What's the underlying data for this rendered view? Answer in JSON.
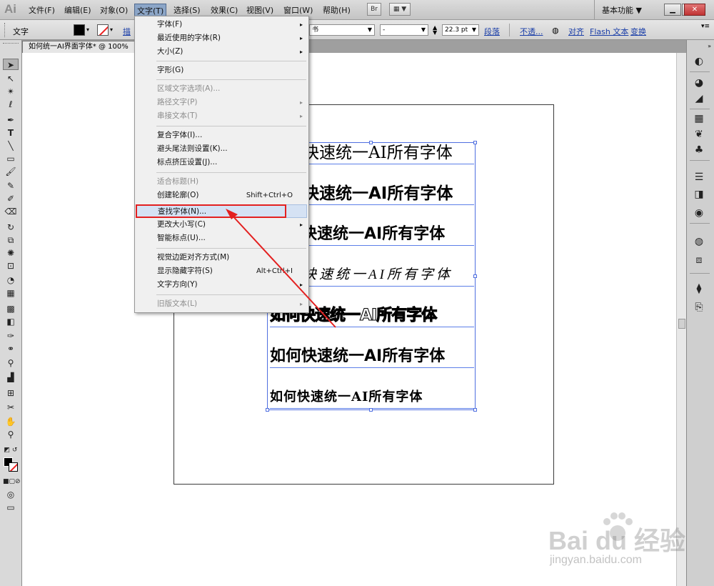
{
  "app": {
    "logo": "Ai",
    "workspace": "基本功能 ▼"
  },
  "menubar": {
    "items": [
      "文件(F)",
      "编辑(E)",
      "对象(O)",
      "文字(T)",
      "选择(S)",
      "效果(C)",
      "视图(V)",
      "窗口(W)",
      "帮助(H)"
    ],
    "br": "Br",
    "grid_arrow": "▼"
  },
  "controlbar": {
    "tool_label": "文字",
    "desc_label": "描",
    "font_style": "-",
    "font_size": "22.3 pt",
    "paragraph": "段落",
    "opacity": "不透...",
    "align": "对齐",
    "flash": "Flash 文本",
    "transform": "变换",
    "font_tail": "书"
  },
  "document": {
    "tab_title": "如何统一AI界面字体* @ 100%"
  },
  "artwork": {
    "lines": [
      "如何快速统一AI所有字体",
      "如何快速统一AI所有字体",
      "如何快速统一AI所有字体",
      "如何快速统一AI所有字体",
      "如何快速统一AI所有字体",
      "如何快速统一AI所有字体",
      "如何快速统一AI所有字体"
    ]
  },
  "dropdown": {
    "items": [
      {
        "label": "字体(F)",
        "sub": "▸",
        "shortcut": ""
      },
      {
        "label": "最近使用的字体(R)",
        "sub": "▸",
        "shortcut": ""
      },
      {
        "label": "大小(Z)",
        "sub": "▸",
        "shortcut": ""
      },
      {
        "label": "字形(G)",
        "sub": "",
        "shortcut": ""
      },
      {
        "label": "区域文字选项(A)...",
        "sub": "",
        "shortcut": ""
      },
      {
        "label": "路径文字(P)",
        "sub": "▸",
        "shortcut": ""
      },
      {
        "label": "串接文本(T)",
        "sub": "▸",
        "shortcut": ""
      },
      {
        "label": "复合字体(I)...",
        "sub": "",
        "shortcut": ""
      },
      {
        "label": "避头尾法则设置(K)...",
        "sub": "",
        "shortcut": ""
      },
      {
        "label": "标点挤压设置(J)...",
        "sub": "",
        "shortcut": ""
      },
      {
        "label": "适合标题(H)",
        "sub": "",
        "shortcut": ""
      },
      {
        "label": "创建轮廓(O)",
        "sub": "",
        "shortcut": "Shift+Ctrl+O"
      },
      {
        "label": "查找字体(N)...",
        "sub": "",
        "shortcut": ""
      },
      {
        "label": "更改大小写(C)",
        "sub": "▸",
        "shortcut": ""
      },
      {
        "label": "智能标点(U)...",
        "sub": "",
        "shortcut": ""
      },
      {
        "label": "视觉边距对齐方式(M)",
        "sub": "",
        "shortcut": ""
      },
      {
        "label": "显示隐藏字符(S)",
        "sub": "",
        "shortcut": "Alt+Ctrl+I"
      },
      {
        "label": "文字方向(Y)",
        "sub": "▸",
        "shortcut": ""
      },
      {
        "label": "旧版文本(L)",
        "sub": "▸",
        "shortcut": ""
      }
    ]
  },
  "watermark": {
    "text": "Bai du 经验",
    "sub": "jingyan.baidu.com"
  },
  "colors": {
    "highlight_box": "#e32020",
    "selection": "#4f6fe0",
    "menu_active": "#8ca6c8"
  }
}
